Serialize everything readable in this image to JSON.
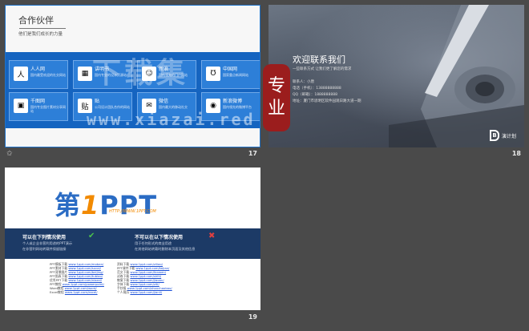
{
  "slide17": {
    "title": "合作伙伴",
    "subtitle": "他们是我们成长的力量",
    "number": "17",
    "partners": [
      {
        "name": "人人网",
        "desc": "国内最受欢迎的社交网站",
        "icon": "renren-icon",
        "glyph": "人"
      },
      {
        "name": "讲明书",
        "desc": "国内专业的设计资源站",
        "icon": "colorful-app-icon",
        "glyph": "▦"
      },
      {
        "name": "新浪",
        "desc": "国内领先的门户网站",
        "icon": "face-icon",
        "glyph": "☺"
      },
      {
        "name": "中国网",
        "desc": "国家重点新闻网站",
        "icon": "cup-icon",
        "glyph": "Ʊ"
      },
      {
        "name": "千图网",
        "desc": "国内专业图片素材分享网站",
        "icon": "green-square-icon",
        "glyph": "▣"
      },
      {
        "name": "贴",
        "desc": "公司设计团队合作的网站",
        "icon": "tie-icon",
        "glyph": "贴"
      },
      {
        "name": "微信",
        "desc": "国内最大的移动社交",
        "icon": "wechat-icon",
        "glyph": "✉"
      },
      {
        "name": "新浪微博",
        "desc": "国内领先的微博平台",
        "icon": "weibo-icon",
        "glyph": "◉"
      }
    ]
  },
  "watermark": {
    "text": "下载集",
    "url": "www.xiazai.red",
    "seal": [
      "专",
      "业"
    ]
  },
  "slide18": {
    "title": "欢迎联系我们",
    "subtitle": "一些联系方式 让我们更了解您的需求",
    "number": "18",
    "contact": [
      "联系人：小唐",
      "电话（手机）：13888888888",
      "QQ（邮箱）：1888888888",
      "地址：厦门市思明区软件园观日路大道一期"
    ],
    "logo": "演计划"
  },
  "slide19": {
    "number": "19",
    "brand_main": "第",
    "brand_one": "1",
    "brand_tail": "PPT",
    "brand_url": "HTTP://WWW.1PPT.COM",
    "can_title": "可以在下列情况使用",
    "can_items": [
      "个人或企业非营利用途的PPT演示",
      "在非营利网站转载并保留链接"
    ],
    "cannot_title": "不可以在以下情况使用",
    "cannot_items": [
      "用于任何形式的商业用途",
      "在其他网站转载时删除本页面及其他信息"
    ],
    "links_left": [
      {
        "k": "PPT模板下载",
        "v": "www.1ppt.com/moban/"
      },
      {
        "k": "PPT素材下载",
        "v": "www.1ppt.com/sucai/"
      },
      {
        "k": "PPT背景图片",
        "v": "www.1ppt.com/beijing/"
      },
      {
        "k": "PPT图表下载",
        "v": "www.1ppt.com/tubiao/"
      },
      {
        "k": "优秀PPT下载",
        "v": "www.1ppt.com/xiazai/"
      },
      {
        "k": "PPT教程",
        "v": "www.1ppt.com/powerpoint/"
      },
      {
        "k": "Word教程",
        "v": "www.1ppt.com/word/"
      },
      {
        "k": "Excel教程",
        "v": "www.1ppt.com/excel/"
      }
    ],
    "links_right": [
      {
        "k": "资料下载",
        "v": "www.1ppt.com/ziliao/"
      },
      {
        "k": "PPT课件下载",
        "v": "www.1ppt.com/kejian/"
      },
      {
        "k": "范文下载",
        "v": "www.1ppt.com/fanwen/"
      },
      {
        "k": "试卷下载",
        "v": "www.1ppt.com/shiti/"
      },
      {
        "k": "教案下载",
        "v": "www.1ppt.com/jiaoan/"
      },
      {
        "k": "字体下载",
        "v": "www.1ppt.com/ziti/"
      },
      {
        "k": "手抄报",
        "v": "www.1ppt.com/shouchaobao/"
      },
      {
        "k": "个人简历",
        "v": "www.1ppt.com/jianli/"
      }
    ]
  },
  "footer_star": "✩"
}
